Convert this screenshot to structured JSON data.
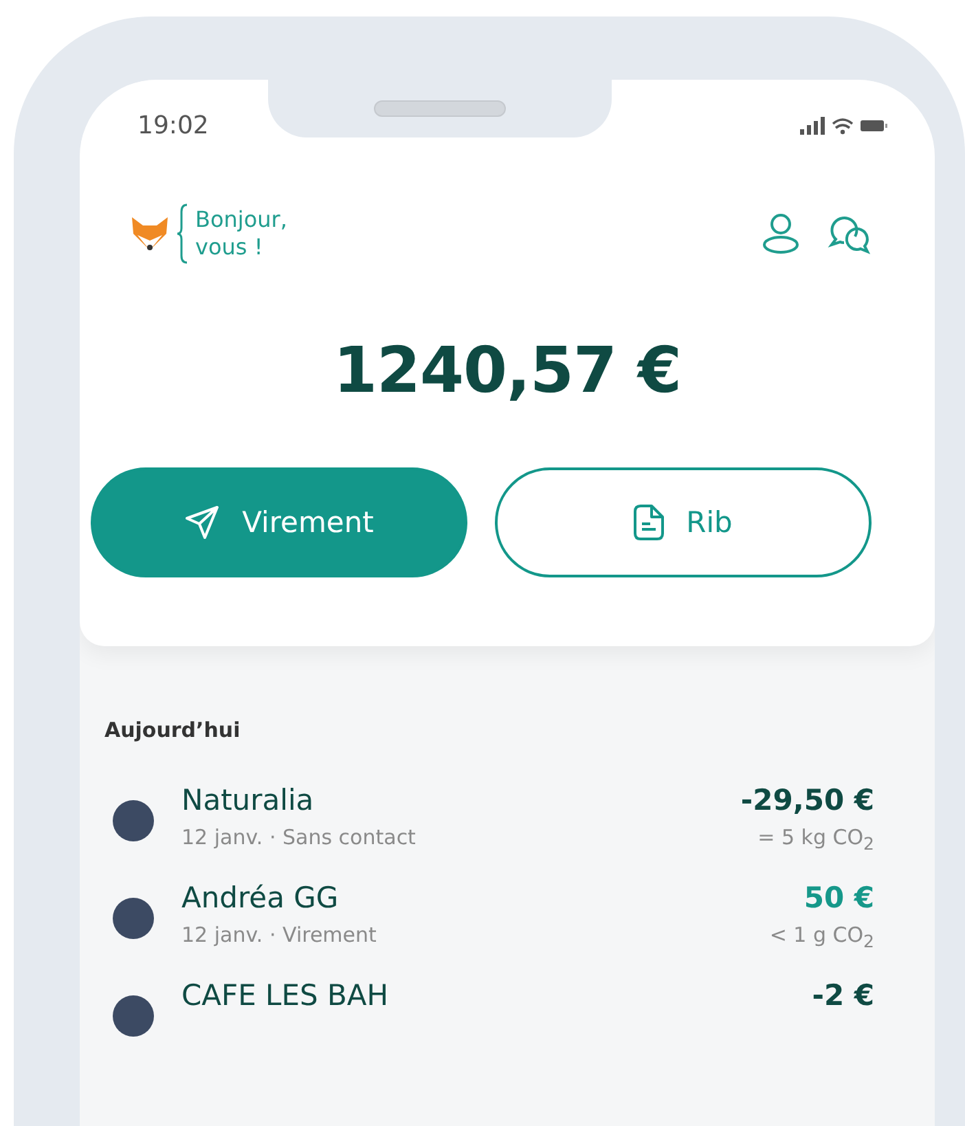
{
  "status_bar": {
    "time": "19:02"
  },
  "header": {
    "greeting": [
      "Bonjour,",
      "vous !"
    ]
  },
  "balance": "1240,57 €",
  "actions": [
    {
      "label": "Virement",
      "kind": "primary"
    },
    {
      "label": "Rib",
      "kind": "outline"
    }
  ],
  "section_title": "Aujourd’hui",
  "transactions": [
    {
      "name": "Naturalia",
      "detail": "12 janv.  · Sans contact",
      "amount": "-29,50 €",
      "kind": "debit",
      "carbon": "= 5 kg CO$_{2}$"
    },
    {
      "name": "Andréa GG",
      "detail": "12 janv.  · Virement",
      "amount": "50 €",
      "kind": "credit",
      "carbon": "< 1 g CO$_{2}$"
    },
    {
      "name": "CAFE LES BAH",
      "amount": "-2 €",
      "kind": "debit"
    }
  ]
}
